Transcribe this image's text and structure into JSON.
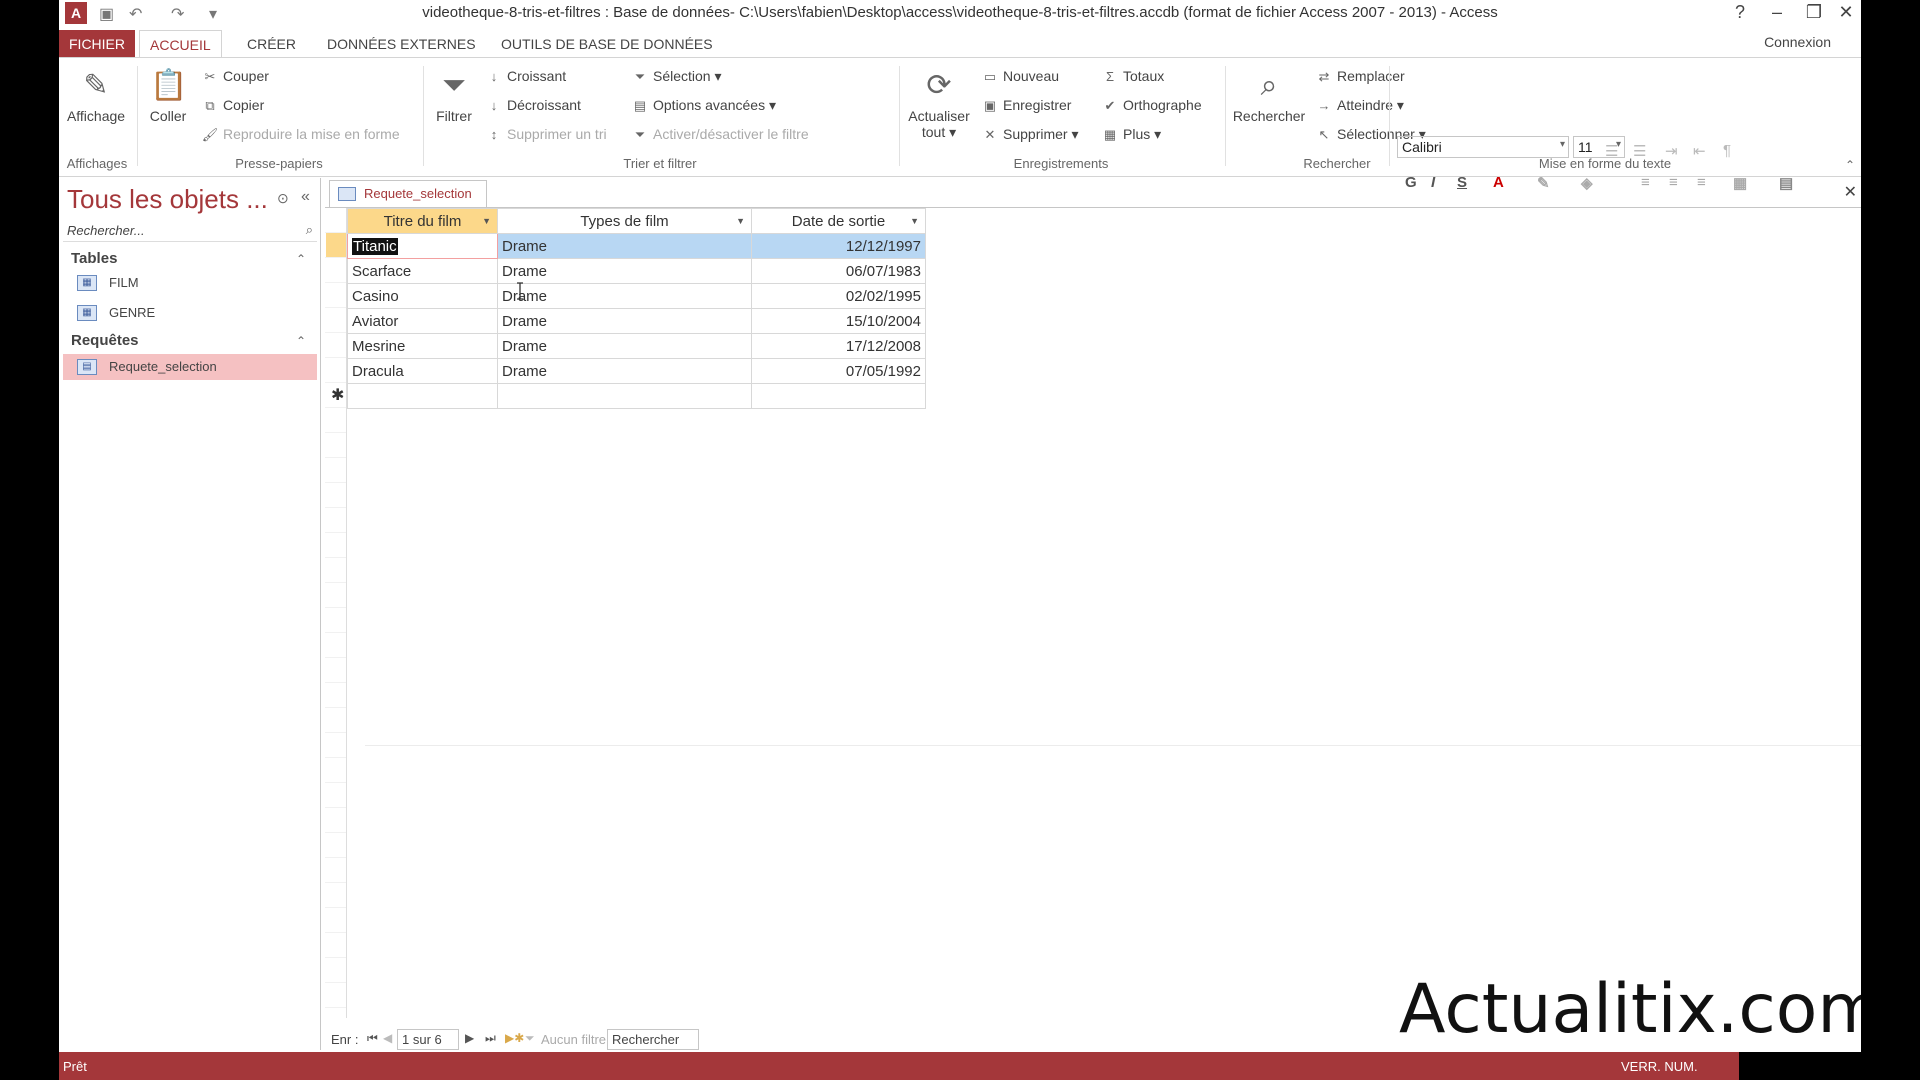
{
  "window": {
    "title": "videotheque-8-tris-et-filtres : Base de données- C:\\Users\\fabien\\Desktop\\access\\videotheque-8-tris-et-filtres.accdb (format de fichier Access 2007 - 2013) - Access",
    "help": "?",
    "minimize": "–",
    "restore": "❐",
    "close": "✕",
    "app_icon": "A"
  },
  "menu": {
    "file": "FICHIER",
    "tabs": [
      "ACCUEIL",
      "CRÉER",
      "DONNÉES EXTERNES",
      "OUTILS DE BASE DE DONNÉES"
    ],
    "connexion": "Connexion"
  },
  "ribbon": {
    "affichages": {
      "view": "Affichage",
      "group": "Affichages"
    },
    "presse": {
      "paste": "Coller",
      "cut": "Couper",
      "copy": "Copier",
      "format_painter": "Reproduire la mise en forme",
      "group": "Presse-papiers"
    },
    "trier": {
      "filter": "Filtrer",
      "asc": "Croissant",
      "desc": "Décroissant",
      "remove_sort": "Supprimer un tri",
      "selection": "Sélection",
      "advanced": "Options avancées",
      "toggle_filter": "Activer/désactiver le filtre",
      "group": "Trier et filtrer"
    },
    "enregistrements": {
      "refresh_line1": "Actualiser",
      "refresh_line2": "tout",
      "new": "Nouveau",
      "save": "Enregistrer",
      "delete": "Supprimer",
      "totals": "Totaux",
      "spelling": "Orthographe",
      "more": "Plus",
      "group": "Enregistrements"
    },
    "rechercher": {
      "find": "Rechercher",
      "replace": "Remplacer",
      "goto": "Atteindre",
      "select": "Sélectionner",
      "group": "Rechercher"
    },
    "texte": {
      "font": "Calibri",
      "size": "11",
      "bold": "G",
      "italic": "I",
      "underline": "S",
      "group": "Mise en forme du texte"
    }
  },
  "nav": {
    "title": "Tous les objets ...",
    "search_placeholder": "Rechercher...",
    "tables_label": "Tables",
    "tables": [
      "FILM",
      "GENRE"
    ],
    "queries_label": "Requêtes",
    "queries": [
      "Requete_selection"
    ]
  },
  "document": {
    "tab_label": "Requete_selection",
    "columns": [
      "Titre du film",
      "Types de film",
      "Date de sortie"
    ],
    "rows": [
      [
        "Titanic",
        "Drame",
        "12/12/1997"
      ],
      [
        "Scarface",
        "Drame",
        "06/07/1983"
      ],
      [
        "Casino",
        "Drame",
        "02/02/1995"
      ],
      [
        "Aviator",
        "Drame",
        "15/10/2004"
      ],
      [
        "Mesrine",
        "Drame",
        "17/12/2008"
      ],
      [
        "Dracula",
        "Drame",
        "07/05/1992"
      ]
    ],
    "new_row_marker": "✱"
  },
  "record_nav": {
    "label": "Enr :",
    "position": "1 sur 6",
    "filter_status": "Aucun filtre",
    "search": "Rechercher"
  },
  "watermark": "Actualitix.com",
  "status": {
    "left": "Prêt",
    "right": "VERR. NUM."
  },
  "colors": {
    "accent": "#a4373a",
    "selected_nav": "#f5c1c2",
    "active_header": "#fcd88a",
    "selected_row": "#b8d7f3"
  }
}
